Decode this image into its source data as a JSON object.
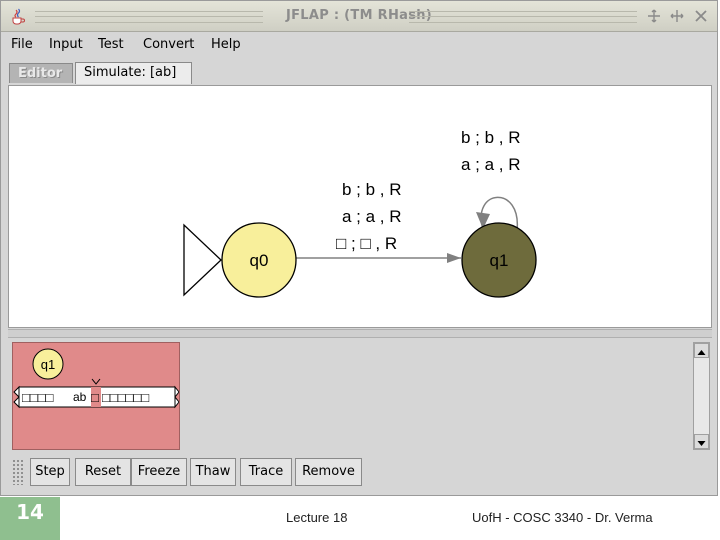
{
  "window": {
    "title": "JFLAP : (TM RHash)"
  },
  "menu": {
    "items": [
      "File",
      "Input",
      "Test",
      "Convert",
      "Help"
    ]
  },
  "tabs": {
    "editor": "Editor",
    "simulate": "Simulate: [ab]"
  },
  "diagram": {
    "states": [
      {
        "label": "q0",
        "initial": true,
        "current": false
      },
      {
        "label": "q1",
        "initial": false,
        "current": true
      }
    ],
    "transition_q0_q1": [
      "b ; b , R",
      "a ; a , R",
      "□ ; □ , R"
    ],
    "loop_q1": [
      "b ; b , R",
      "a ; a , R"
    ],
    "colors": {
      "state_fill": "#f8ef9b",
      "current_state_fill": "#6e6b3c",
      "edge": "#808080"
    }
  },
  "simulation": {
    "config_state": "q1",
    "tape_left": "□□□□",
    "tape_input": "ab",
    "tape_head": "□",
    "tape_right": "□□□□□□",
    "config_color": "#e08a8a"
  },
  "buttons": {
    "step": "Step",
    "reset": "Reset",
    "freeze": "Freeze",
    "thaw": "Thaw",
    "trace": "Trace",
    "remove": "Remove"
  },
  "footer": {
    "slide_number": "14",
    "center": "Lecture 18",
    "right": "UofH - COSC 3340 - Dr. Verma"
  }
}
